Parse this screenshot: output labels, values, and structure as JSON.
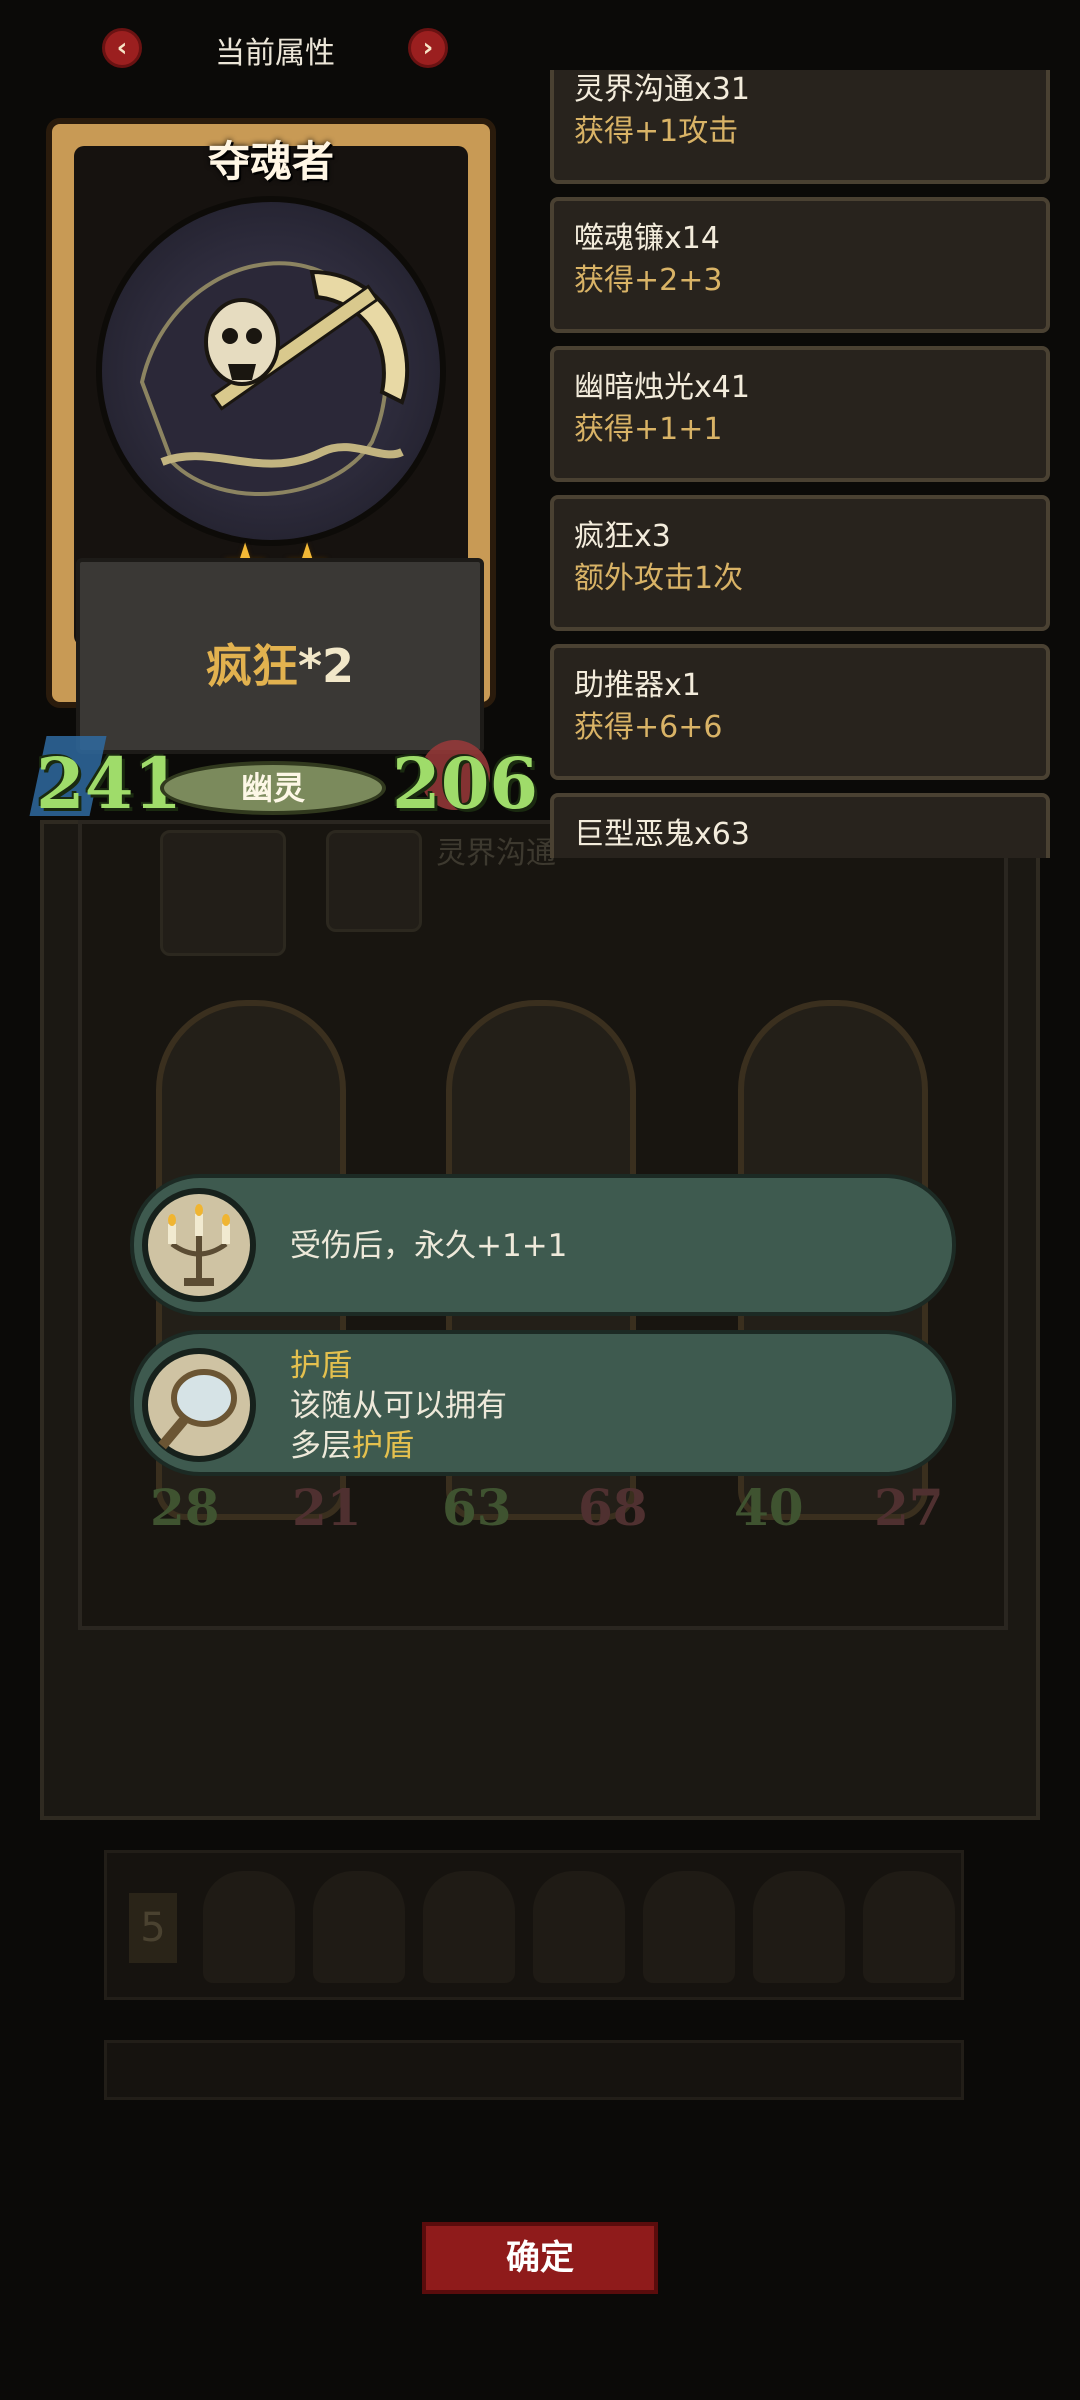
{
  "header": {
    "title": "当前属性"
  },
  "hero": {
    "name": "夺魂者",
    "stars": 2,
    "ability_keyword": "疯狂",
    "ability_suffix": "*2",
    "tribe": "幽灵",
    "attack": "241",
    "health": "206"
  },
  "buffs": [
    {
      "name": "灵界沟通x31",
      "effect": "获得+1攻击"
    },
    {
      "name": "噬魂镰x14",
      "effect": "获得+2+3"
    },
    {
      "name": "幽暗烛光x41",
      "effect": "获得+1+1"
    },
    {
      "name": "疯狂x3",
      "effect": "额外攻击1次"
    },
    {
      "name": "助推器x1",
      "effect": "获得+6+6"
    },
    {
      "name": "巨型恶鬼x63",
      "effect": ""
    }
  ],
  "tooltips": [
    {
      "lines": [
        "受伤后，永久+1+1"
      ]
    },
    {
      "title": "护盾",
      "line1": "该随从可以拥有",
      "line2_prefix": "多层",
      "line2_keyword": "护盾"
    }
  ],
  "background": {
    "desc": "灵界沟通",
    "bench_badge": "5",
    "board_stats": [
      "28",
      "21",
      "63",
      "68",
      "40",
      "27"
    ]
  },
  "confirm_label": "确定",
  "colors": {
    "stat_green": "#9fdc6a",
    "gold": "#e4c04e",
    "confirm_red": "#8f1b1b"
  }
}
